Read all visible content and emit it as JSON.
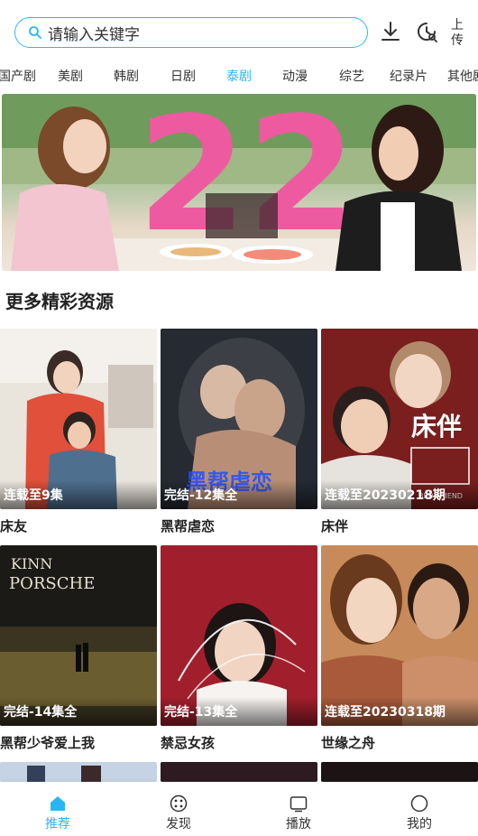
{
  "search": {
    "placeholder": "请输入关键字"
  },
  "header": {
    "upload_label": "上传"
  },
  "tabs": [
    "国产剧",
    "美剧",
    "韩剧",
    "日剧",
    "泰剧",
    "动漫",
    "综艺",
    "纪录片",
    "其他剧"
  ],
  "active_tab": "泰剧",
  "section_title": "更多精彩资源",
  "cards": [
    {
      "status": "连载至9集",
      "title": "床友"
    },
    {
      "status": "完结-12集全",
      "title": "黑帮虐恋"
    },
    {
      "status": "连载至20230218期",
      "title": "床伴"
    },
    {
      "status": "完结-14集全",
      "title": "黑帮少爷爱上我"
    },
    {
      "status": "完结-13集全",
      "title": "禁忌女孩"
    },
    {
      "status": "连载至20230318期",
      "title": "世缘之舟"
    }
  ],
  "nav": [
    {
      "label": "推荐",
      "icon": "home-icon"
    },
    {
      "label": "发现",
      "icon": "discover-icon"
    },
    {
      "label": "播放",
      "icon": "play-window-icon"
    },
    {
      "label": "我的",
      "icon": "profile-icon"
    }
  ],
  "colors": {
    "accent": "#29b6f6",
    "banner_pink": "#ee5aa0"
  }
}
